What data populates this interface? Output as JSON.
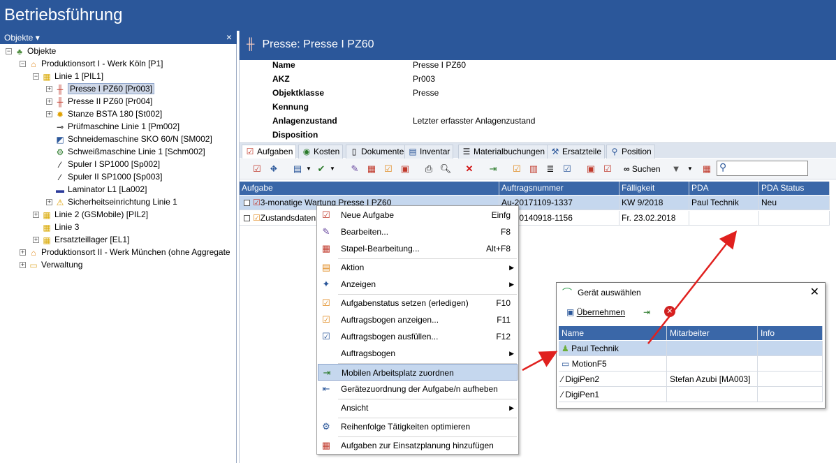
{
  "app": {
    "title": "Betriebsführung"
  },
  "left": {
    "header": "Objekte",
    "header_caret": "▾",
    "close": "×",
    "tree": [
      {
        "label": "Objekte",
        "icon": "objects-icon"
      },
      {
        "label": "Produktionsort I - Werk Köln [P1]",
        "icon": "site-icon"
      },
      {
        "label": "Linie 1 [PIL1]",
        "icon": "line-icon"
      },
      {
        "label": "Presse I PZ60 [Pr003]",
        "icon": "press-icon"
      },
      {
        "label": "Presse II PZ60 [Pr004]",
        "icon": "press-icon"
      },
      {
        "label": "Stanze BSTA 180 [St002]",
        "icon": "gear-icon"
      },
      {
        "label": "Prüfmaschine Linie 1 [Pm002]",
        "icon": "test-machine-icon"
      },
      {
        "label": "Schneidemaschine SKO 60/N [SM002]",
        "icon": "cutter-icon"
      },
      {
        "label": "Schweißmaschine Linie 1 [Schm002]",
        "icon": "welding-icon"
      },
      {
        "label": "Spuler I SP1000 [Sp002]",
        "icon": "spooler-icon"
      },
      {
        "label": "Spuler II SP1000 [Sp003]",
        "icon": "spooler-icon"
      },
      {
        "label": "Laminator L1 [La002]",
        "icon": "laminator-icon"
      },
      {
        "label": "Sicherheitseinrichtung Linie 1",
        "icon": "warning-icon"
      },
      {
        "label": "Linie 2 (GSMobile) [PIL2]",
        "icon": "line-icon"
      },
      {
        "label": "Linie 3",
        "icon": "line-icon"
      },
      {
        "label": "Ersatzteillager [EL1]",
        "icon": "line-icon"
      },
      {
        "label": "Produktionsort II - Werk München (ohne Aggregate",
        "icon": "site-icon"
      },
      {
        "label": "Verwaltung",
        "icon": "folder-icon"
      }
    ]
  },
  "detail": {
    "title": "Presse: Presse I PZ60",
    "props": [
      {
        "label": "Name",
        "value": "Presse I PZ60"
      },
      {
        "label": "AKZ",
        "value": "Pr003"
      },
      {
        "label": "Objektklasse",
        "value": "Presse"
      },
      {
        "label": "Kennung",
        "value": ""
      },
      {
        "label": "Anlagenzustand",
        "value": "Letzter erfasster Anlagenzustand"
      },
      {
        "label": "Disposition",
        "value": ""
      }
    ],
    "tabs": [
      {
        "label": "Aufgaben",
        "icon": "tasks-icon"
      },
      {
        "label": "Kosten",
        "icon": "costs-icon"
      },
      {
        "label": "Dokumente",
        "icon": "document-icon"
      },
      {
        "label": "Inventar",
        "icon": "inventory-icon"
      },
      {
        "label": "Materialbuchungen",
        "icon": "material-icon"
      },
      {
        "label": "Ersatzteile",
        "icon": "spare-parts-icon"
      },
      {
        "label": "Position",
        "icon": "location-icon"
      }
    ],
    "search_label": "Suchen",
    "grid": {
      "columns": [
        "Aufgabe",
        "Auftragsnummer",
        "Fälligkeit",
        "PDA",
        "PDA Status"
      ],
      "rows": [
        [
          "3-monatige Wartung Presse I PZ60",
          "Au-20171109-1337",
          "KW 9/2018",
          "Paul Technik",
          "Neu"
        ],
        [
          "Zustandsdaten",
          "Au-20140918-1156",
          "Fr. 23.02.2018",
          "",
          ""
        ]
      ]
    }
  },
  "context_menu": {
    "items": [
      {
        "label": "Neue Aufgabe",
        "shortcut": "Einfg",
        "icon": "new-task-icon"
      },
      {
        "label": "Bearbeiten...",
        "shortcut": "F8",
        "icon": "edit-icon"
      },
      {
        "label": "Stapel-Bearbeitung...",
        "shortcut": "Alt+F8",
        "icon": "batch-edit-icon"
      },
      {
        "label": "Aktion",
        "shortcut": "",
        "icon": "action-icon",
        "submenu": true
      },
      {
        "label": "Anzeigen",
        "shortcut": "",
        "icon": "pin-icon",
        "submenu": true
      },
      {
        "label": "Aufgabenstatus setzen (erledigen)",
        "shortcut": "F10",
        "icon": "status-icon"
      },
      {
        "label": "Auftragsbogen anzeigen...",
        "shortcut": "F11",
        "icon": "show-form-icon"
      },
      {
        "label": "Auftragsbogen ausfüllen...",
        "shortcut": "F12",
        "icon": "fill-form-icon"
      },
      {
        "label": "Auftragsbogen",
        "shortcut": "",
        "icon": "",
        "submenu": true
      },
      {
        "label": "Mobilen Arbeitsplatz zuordnen",
        "shortcut": "",
        "icon": "assign-mobile-icon"
      },
      {
        "label": "Gerätezuordnung der Aufgabe/n aufheben",
        "shortcut": "",
        "icon": "unassign-device-icon"
      },
      {
        "label": "Ansicht",
        "shortcut": "",
        "icon": "",
        "submenu": true
      },
      {
        "label": "Reihenfolge Tätigkeiten optimieren",
        "shortcut": "",
        "icon": "optimize-icon"
      },
      {
        "label": "Aufgaben zur Einsatzplanung hinzufügen",
        "shortcut": "",
        "icon": "planning-icon"
      }
    ],
    "arrow": "▶"
  },
  "dialog": {
    "title": "Gerät auswählen",
    "close": "✕",
    "apply_label": "Übernehmen",
    "columns": [
      "Name",
      "Mitarbeiter",
      "Info"
    ],
    "rows": [
      {
        "name": "Paul Technik",
        "employee": "",
        "info": "",
        "icon": "android-icon"
      },
      {
        "name": "MotionF5",
        "employee": "",
        "info": "",
        "icon": "laptop-icon"
      },
      {
        "name": "DigiPen2",
        "employee": "Stefan Azubi [MA003]",
        "info": "",
        "icon": "pen-icon"
      },
      {
        "name": "DigiPen1",
        "employee": "",
        "info": "",
        "icon": "pen-icon"
      }
    ]
  },
  "colors": {
    "accent": "#2b579a",
    "grid_header": "#3a67a8",
    "highlight": "#c5d7ee",
    "annotation": "#e0201e"
  }
}
